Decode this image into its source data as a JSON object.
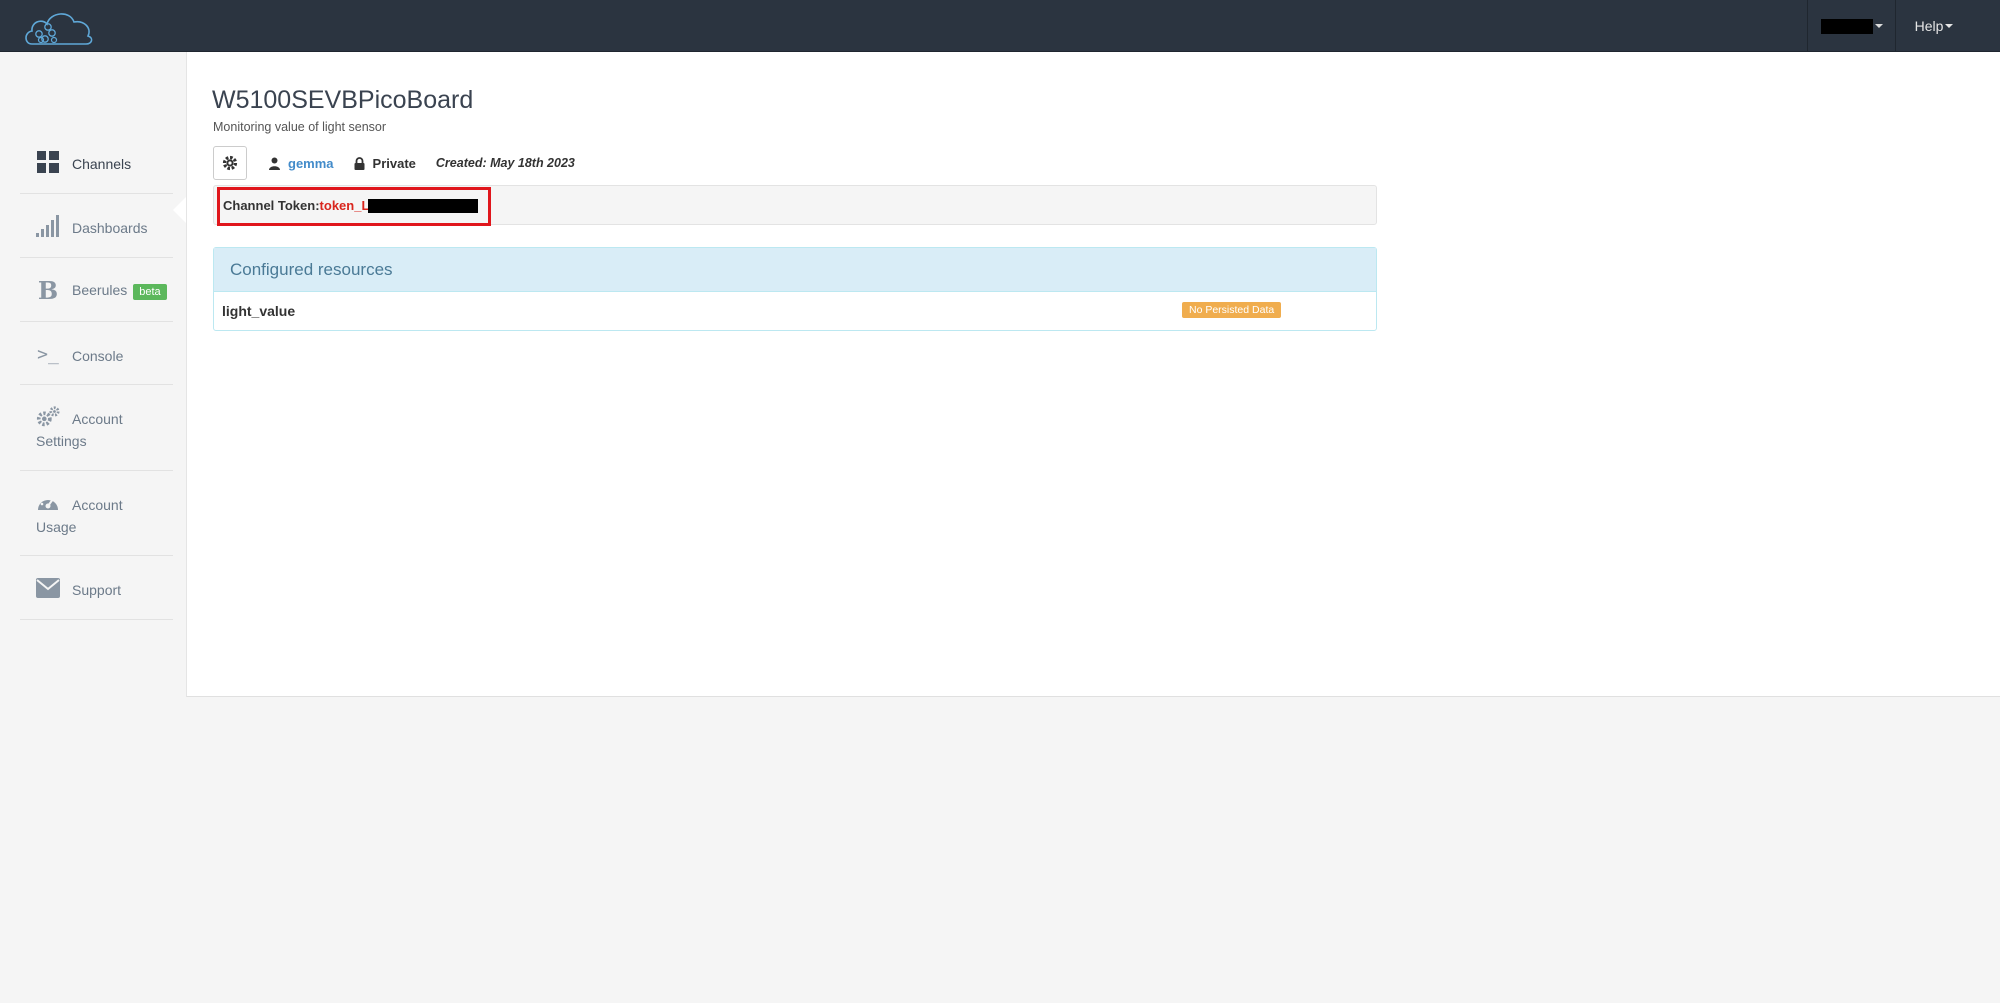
{
  "header": {
    "logo_icon": "cloud-logo-icon",
    "help_label": "Help"
  },
  "sidebar": {
    "items": [
      {
        "label": "Channels",
        "icon": "grid-icon"
      },
      {
        "label": "Dashboards",
        "icon": "signal-bars-icon"
      },
      {
        "label": "Beerules",
        "icon": "b-letter-icon",
        "badge": "beta"
      },
      {
        "label": "Console",
        "icon": "terminal-prompt-icon"
      },
      {
        "label": "Account Settings",
        "label_line1": "Account",
        "label_line2": "Settings",
        "icon": "gears-icon"
      },
      {
        "label": "Account Usage",
        "label_line1": "Account",
        "label_line2": "Usage",
        "icon": "dashboard-gauge-icon"
      },
      {
        "label": "Support",
        "icon": "envelope-icon"
      }
    ]
  },
  "channel": {
    "title": "W5100SEVBPicoBoard",
    "description": "Monitoring value of light sensor",
    "owner": "gemma",
    "privacy": "Private",
    "created": "Created: May 18th 2023"
  },
  "token": {
    "label": "Channel Token:",
    "value": "token_L"
  },
  "resources": {
    "heading": "Configured resources",
    "items": [
      {
        "name": "light_value",
        "status": "No Persisted Data"
      }
    ]
  },
  "colors": {
    "navbar": "#2b3440",
    "highlight": "#e0161c",
    "token_value": "#d9251d",
    "badge_warning": "#f0ad4e",
    "beta_badge": "#5cb85c"
  }
}
